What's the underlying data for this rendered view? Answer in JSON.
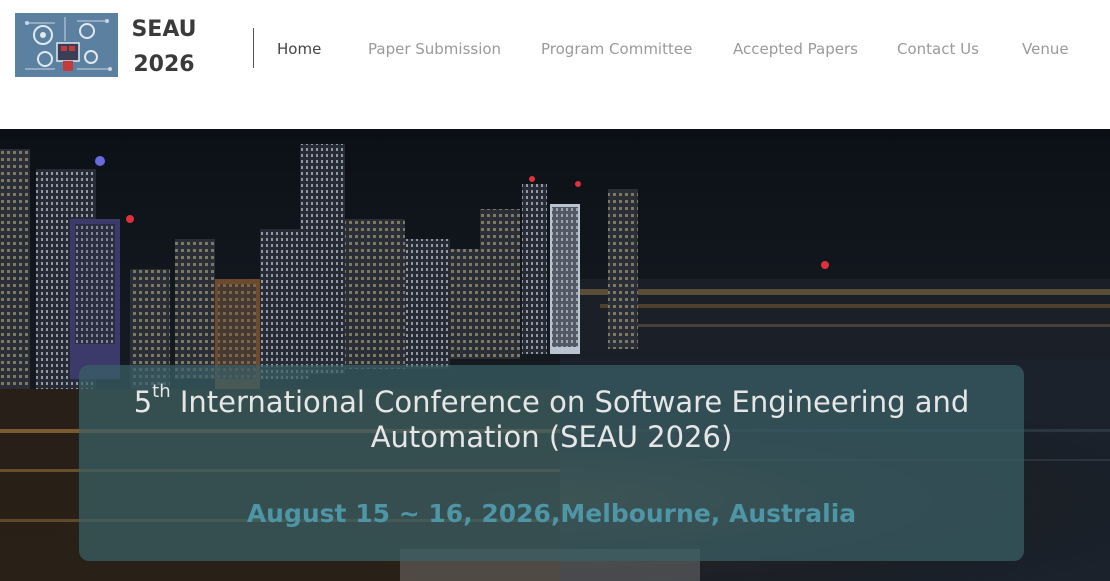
{
  "brand": {
    "line1": "SEAU",
    "line2": "2026",
    "logo_icon": "gear-circuit-logo-icon"
  },
  "nav": {
    "items": [
      {
        "label": "Home",
        "active": true
      },
      {
        "label": "Paper Submission",
        "active": false
      },
      {
        "label": "Program Committee",
        "active": false
      },
      {
        "label": "Accepted Papers",
        "active": false
      },
      {
        "label": "Contact Us",
        "active": false
      },
      {
        "label": "Venue",
        "active": false
      }
    ]
  },
  "hero": {
    "ordinal": "5",
    "ordinal_suffix": "th",
    "title_rest_line1": " International Conference on Software Engineering and",
    "title_line2": "Automation (SEAU 2026)",
    "date_location": "August 15 ~ 16, 2026,Melbourne, Australia"
  },
  "colors": {
    "box_bg": "#3a6066",
    "date_text": "#4e95a6",
    "title_text": "#e6e6e6",
    "nav_active": "#444444",
    "nav_inactive": "#9a9a9a"
  }
}
